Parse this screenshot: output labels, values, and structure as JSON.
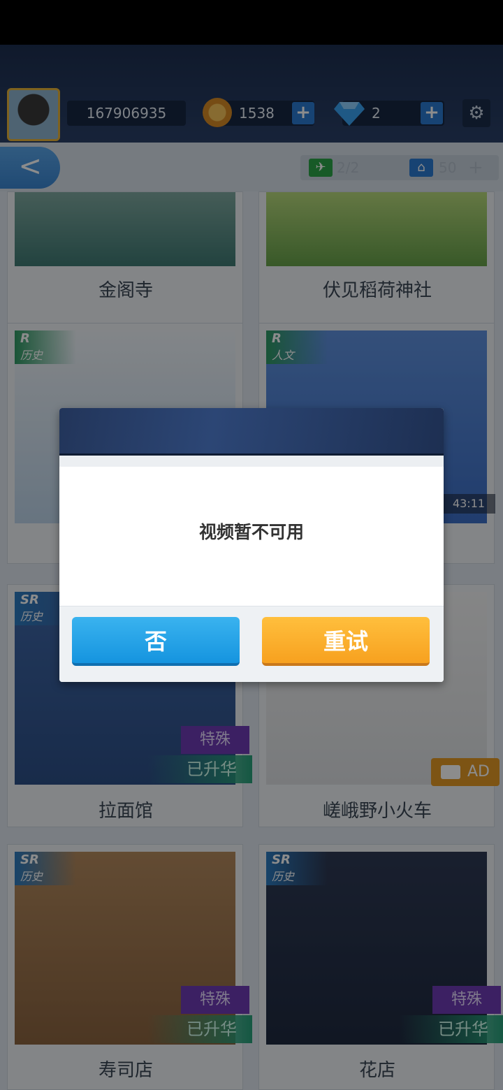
{
  "header": {
    "player_id": "167906935",
    "coins": "1538",
    "gems": "2",
    "coin_plus": "+",
    "gem_plus": "+"
  },
  "subbar": {
    "back_glyph": "<",
    "plus_glyph": "+",
    "slot_count": "2/2",
    "house_count": "50"
  },
  "cards": [
    {
      "name": "金阁寺"
    },
    {
      "name": "伏见稻荷神社"
    },
    {
      "rarity": "R",
      "category": "历史"
    },
    {
      "rarity": "R",
      "category": "人文",
      "timer": "43:11"
    },
    {
      "rarity": "SR",
      "category": "历史",
      "special": "特殊",
      "upgraded": "已升华",
      "name": "拉面馆"
    },
    {
      "ad": "AD",
      "name": "嵯峨野小火车"
    },
    {
      "rarity": "SR",
      "category": "历史",
      "special": "特殊",
      "upgraded": "已升华",
      "name": "寿司店"
    },
    {
      "rarity": "SR",
      "category": "历史",
      "special": "特殊",
      "upgraded": "已升华",
      "name": "花店"
    }
  ],
  "dialog": {
    "message": "视频暂不可用",
    "no_label": "否",
    "retry_label": "重试"
  },
  "colors": {
    "accent_blue": "#1594df",
    "accent_orange": "#f7a11f",
    "header_navy": "#1d2f50"
  },
  "icons": [
    "avatar",
    "coin-icon",
    "gem-icon",
    "gear-icon",
    "back-arrow-icon",
    "video-camera-icon",
    "gift-icon"
  ]
}
